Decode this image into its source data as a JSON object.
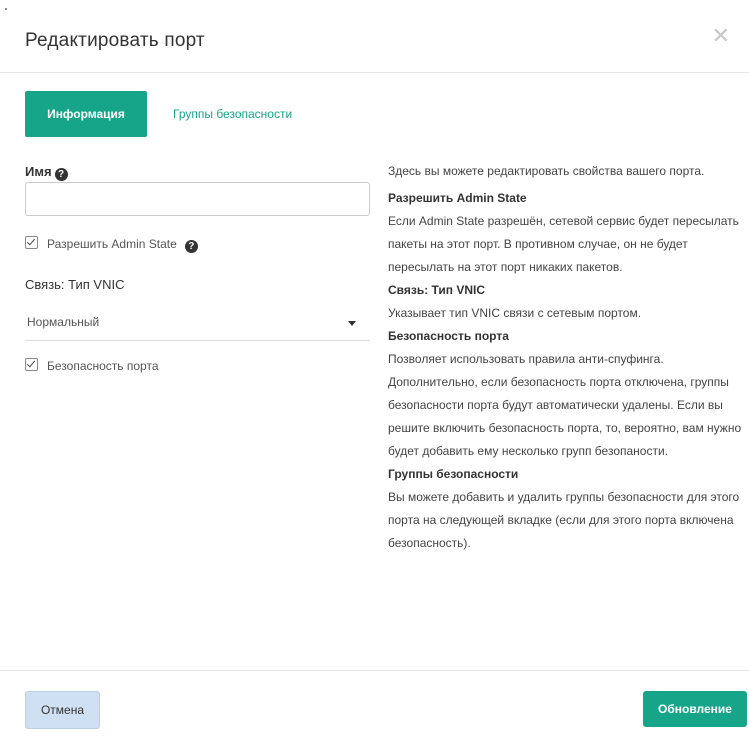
{
  "modal": {
    "title": "Редактировать порт",
    "close_symbol": "✕"
  },
  "tabs": [
    {
      "label": "Информация",
      "active": true
    },
    {
      "label": "Группы безопасности",
      "active": false
    }
  ],
  "form": {
    "name_label": "Имя",
    "name_value": "",
    "admin_state_label": "Разрешить Admin State",
    "admin_state_checked": true,
    "vnic_label": "Связь: Тип VNIC",
    "vnic_selected": "Нормальный",
    "port_security_label": "Безопасность порта",
    "port_security_checked": true
  },
  "help": {
    "intro": "Здесь вы можете редактировать свойства вашего порта.",
    "sections": [
      {
        "heading": "Разрешить Admin State",
        "text": "Если Admin State разрешён, сетевой сервис будет пересылать пакеты на этот порт. В противном случае, он не будет пересылать на этот порт никаких пакетов."
      },
      {
        "heading": "Связь: Тип VNIC",
        "text": "Указывает тип VNIC связи с сетевым портом."
      },
      {
        "heading": "Безопасность порта",
        "text": "Позволяет использовать правила анти-спуфинга. Дополнительно, если безопасность порта отключена, группы безопасности порта будут автоматически удалены. Если вы решите включить безопасность порта, то, вероятно, вам нужно будет добавить ему несколько групп безопаности."
      },
      {
        "heading": "Группы безопасности",
        "text": "Вы можете добавить и удалить группы безопасности для этого порта на следующей вкладке (если для этого порта включена безопасность)."
      }
    ]
  },
  "footer": {
    "cancel_label": "Отмена",
    "update_label": "Обновление"
  },
  "colors": {
    "accent": "#17a589",
    "cancel_bg": "#cfe0f3"
  },
  "icons": [
    "close-icon",
    "help-icon",
    "checkbox-icon",
    "caret-down-icon"
  ]
}
